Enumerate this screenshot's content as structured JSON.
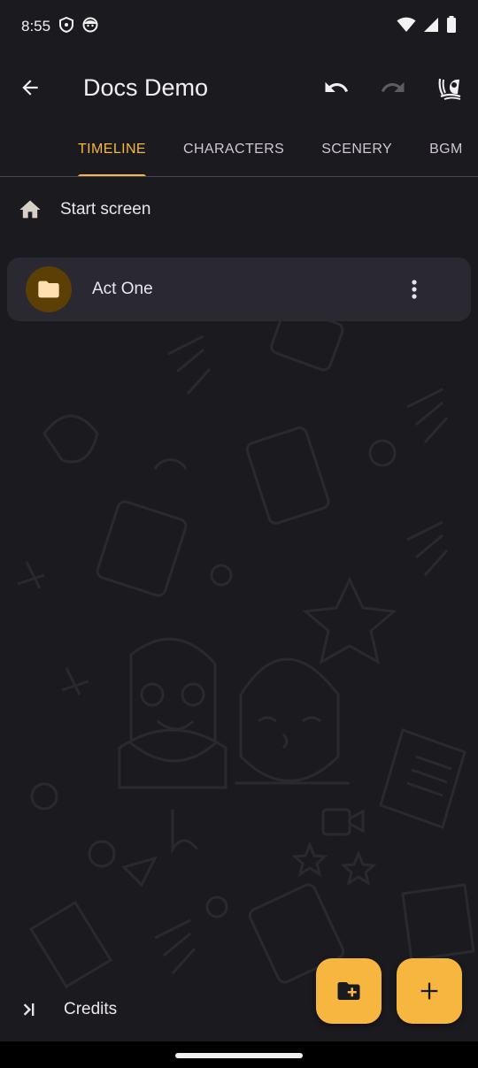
{
  "status_bar": {
    "time": "8:55",
    "icons": [
      "shield-icon",
      "face-icon",
      "wifi-icon",
      "signal-icon",
      "battery-icon"
    ]
  },
  "app_bar": {
    "title": "Docs Demo",
    "icons": [
      "back-arrow-icon",
      "undo-icon",
      "redo-icon",
      "app-logo-icon"
    ]
  },
  "tabs": [
    {
      "label": "TIMELINE",
      "active": true
    },
    {
      "label": "CHARACTERS",
      "active": false
    },
    {
      "label": "SCENERY",
      "active": false
    },
    {
      "label": "BGM",
      "active": false
    }
  ],
  "timeline": {
    "start": {
      "label": "Start screen",
      "icon": "home-icon"
    },
    "items": [
      {
        "label": "Act One",
        "icon": "folder-icon",
        "menu_icon": "more-vert-icon"
      }
    ],
    "end": {
      "label": "Credits",
      "icon": "skip-end-icon"
    }
  },
  "fabs": [
    {
      "name": "add-folder-button",
      "icon": "folder-plus-icon"
    },
    {
      "name": "add-item-button",
      "icon": "plus-icon"
    }
  ],
  "colors": {
    "accent": "#f6b640",
    "background": "#1b1a1f",
    "card": "#2a2830",
    "folder_avatar": "#5b3f05"
  }
}
